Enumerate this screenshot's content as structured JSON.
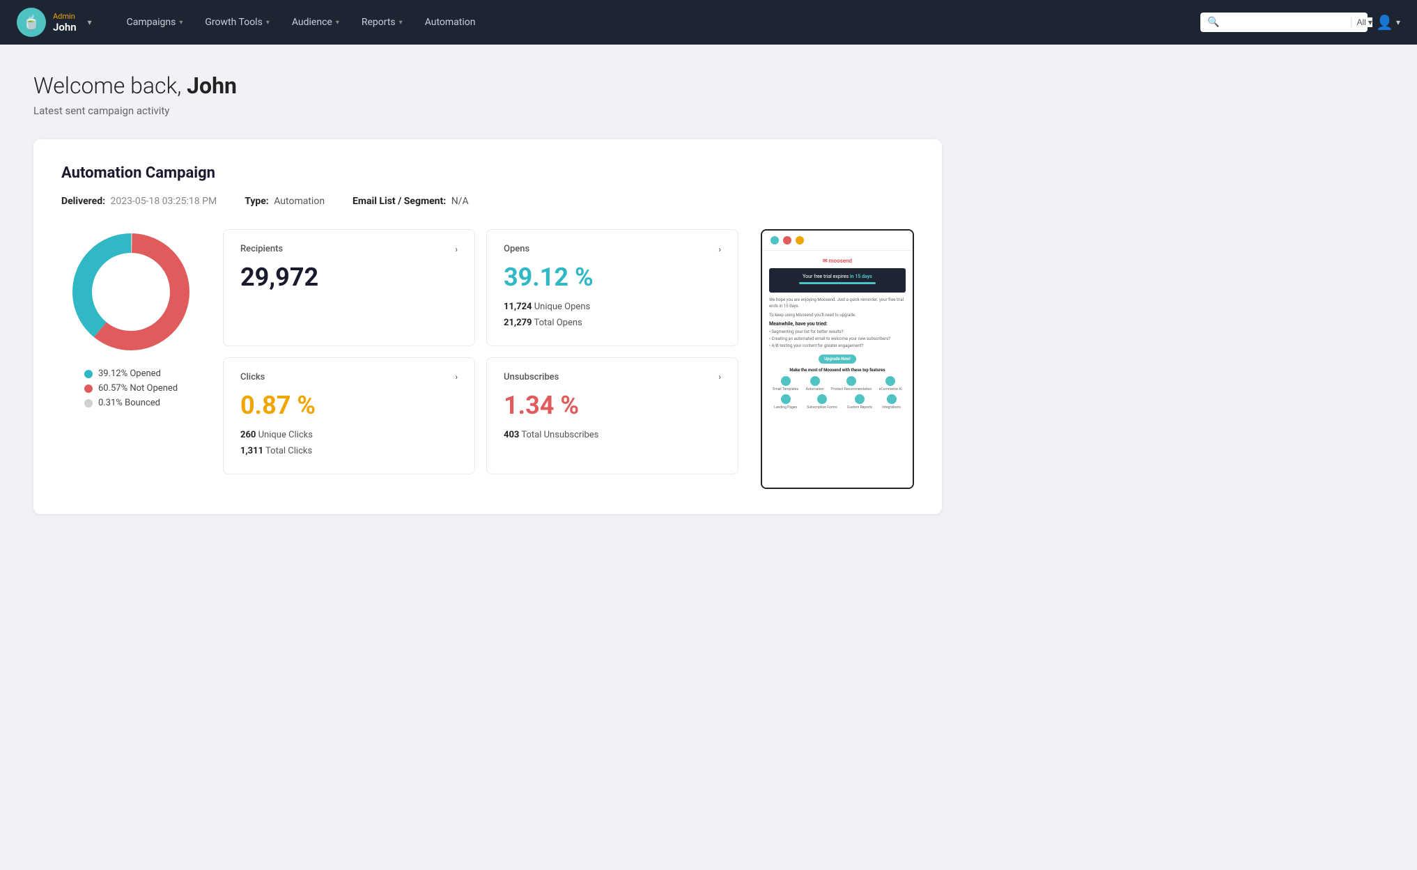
{
  "nav": {
    "logo_emoji": "🍵",
    "admin_label": "Admin",
    "user_name": "John",
    "links": [
      {
        "label": "Campaigns",
        "has_dropdown": true
      },
      {
        "label": "Growth Tools",
        "has_dropdown": true
      },
      {
        "label": "Audience",
        "has_dropdown": true
      },
      {
        "label": "Reports",
        "has_dropdown": true
      },
      {
        "label": "Automation",
        "has_dropdown": false
      }
    ],
    "search_placeholder": "",
    "search_all_label": "All",
    "profile_icon": "👤"
  },
  "page": {
    "welcome_prefix": "Welcome back, ",
    "welcome_name": "John",
    "subtitle": "Latest sent campaign activity"
  },
  "campaign": {
    "title": "Automation Campaign",
    "delivered_label": "Delivered:",
    "delivered_value": "2023-05-18 03:25:18 PM",
    "type_label": "Type:",
    "type_value": "Automation",
    "segment_label": "Email List / Segment:",
    "segment_value": "N/A",
    "donut": {
      "opened_pct": 39.12,
      "not_opened_pct": 60.57,
      "bounced_pct": 0.31,
      "colors": {
        "opened": "#30b8c4",
        "not_opened": "#e05c5c",
        "bounced": "#d0d0d0"
      }
    },
    "legend": [
      {
        "label": "39.12% Opened",
        "color": "#30b8c4"
      },
      {
        "label": "60.57% Not Opened",
        "color": "#e05c5c"
      },
      {
        "label": "0.31% Bounced",
        "color": "#d0d0d0"
      }
    ],
    "stats": {
      "recipients": {
        "label": "Recipients",
        "value": "29,972",
        "color": "dark"
      },
      "opens": {
        "label": "Opens",
        "value": "39.12 %",
        "color": "teal",
        "detail1_num": "11,724",
        "detail1_text": "Unique Opens",
        "detail2_num": "21,279",
        "detail2_text": "Total Opens"
      },
      "clicks": {
        "label": "Clicks",
        "value": "0.87 %",
        "color": "yellow",
        "detail1_num": "260",
        "detail1_text": "Unique Clicks",
        "detail2_num": "1,311",
        "detail2_text": "Total Clicks"
      },
      "unsubscribes": {
        "label": "Unsubscribes",
        "value": "1.34 %",
        "color": "red",
        "detail1_num": "403",
        "detail1_text": "Total Unsubscribes"
      }
    },
    "email_preview": {
      "banner_text_before": "Your free trial expires ",
      "banner_text_strong": "in 15 days",
      "body_p1": "We hope you are enjoying Moosend. Just a quick reminder: your free trial ends in 15 days.",
      "body_p2": "To keep using Moosend you'll need to upgrade.",
      "heading": "Meanwhile, have you tried:",
      "list": [
        "• Segmenting your list for better results?",
        "• Creating an automated email to welcome your new subscribers?",
        "• A/B testing your content for greater engagement?"
      ],
      "cta": "Upgrade Now!",
      "features_title": "Make the most of Moosend with these top features",
      "icons": [
        {
          "label": "Email Templates"
        },
        {
          "label": "Automation"
        },
        {
          "label": "Product Recommendation"
        },
        {
          "label": "eCommerce AI"
        }
      ],
      "icons2": [
        {
          "label": "Landing Pages"
        },
        {
          "label": "Subscription Forms"
        },
        {
          "label": "Custom Reports"
        },
        {
          "label": "Integrations"
        }
      ]
    }
  }
}
